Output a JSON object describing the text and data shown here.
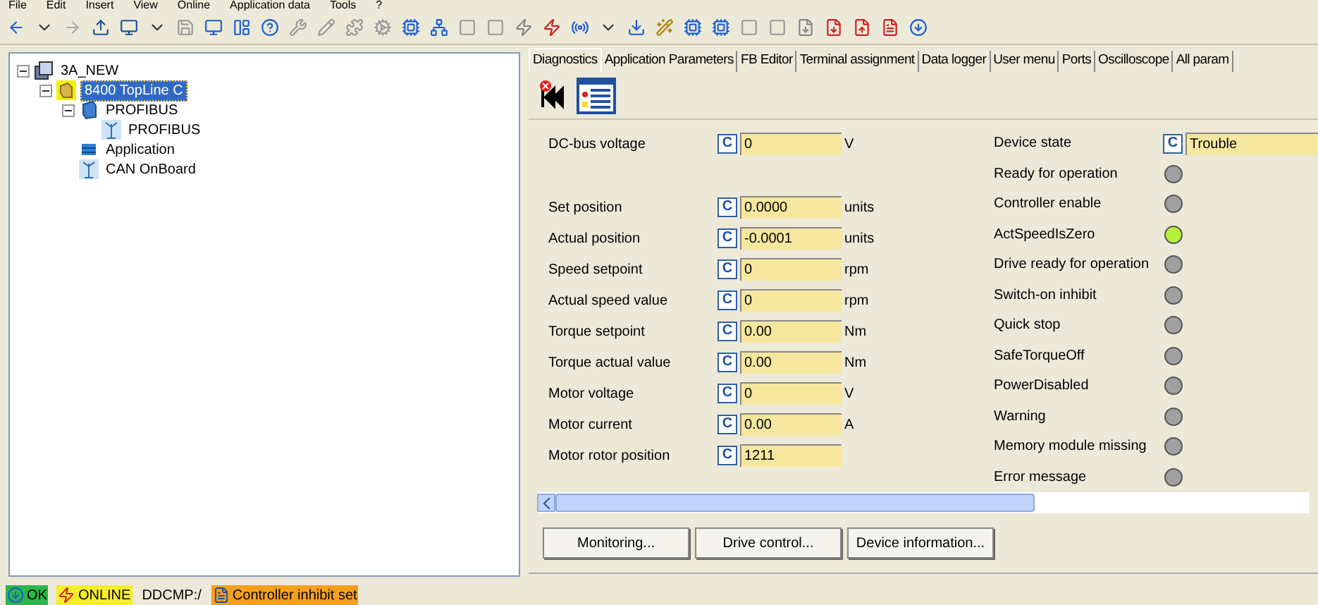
{
  "menu": [
    "File",
    "Edit",
    "Insert",
    "View",
    "Online",
    "Application data",
    "Tools",
    "?"
  ],
  "tree": [
    {
      "label": "3A_NEW",
      "kind": "project",
      "selected": false,
      "expanded": true,
      "children": [
        {
          "label": "8400 TopLine C",
          "kind": "device",
          "selected": true,
          "expanded": true,
          "children": [
            {
              "label": "PROFIBUS",
              "kind": "module",
              "selected": false,
              "expanded": true,
              "children": [
                {
                  "label": "PROFIBUS",
                  "kind": "bus",
                  "selected": false
                }
              ]
            },
            {
              "label": "Application",
              "kind": "app",
              "selected": false
            },
            {
              "label": "CAN OnBoard",
              "kind": "bus",
              "selected": false
            }
          ]
        }
      ]
    }
  ],
  "tabs": [
    {
      "label": "Diagnostics",
      "selected": true
    },
    {
      "label": "Application Parameters",
      "selected": false
    },
    {
      "label": "FB Editor",
      "selected": false
    },
    {
      "label": "Terminal assignment",
      "selected": false
    },
    {
      "label": "Data logger",
      "selected": false
    },
    {
      "label": "User menu",
      "selected": false
    },
    {
      "label": "Ports",
      "selected": false
    },
    {
      "label": "Oscilloscope",
      "selected": false
    },
    {
      "label": "All param",
      "selected": false
    }
  ],
  "parameters": [
    {
      "label": "DC-bus voltage",
      "button": "C",
      "value": "0",
      "unit": "V"
    },
    {
      "label": "Set position",
      "button": "C",
      "value": "0.0000",
      "unit": "units"
    },
    {
      "label": "Actual position",
      "button": "C",
      "value": "-0.0001",
      "unit": "units"
    },
    {
      "label": "Speed setpoint",
      "button": "C",
      "value": "0",
      "unit": "rpm"
    },
    {
      "label": "Actual speed value",
      "button": "C",
      "value": "0",
      "unit": "rpm"
    },
    {
      "label": "Torque setpoint",
      "button": "C",
      "value": "0.00",
      "unit": "Nm"
    },
    {
      "label": "Torque actual value",
      "button": "C",
      "value": "0.00",
      "unit": "Nm"
    },
    {
      "label": "Motor voltage",
      "button": "C",
      "value": "0",
      "unit": "V"
    },
    {
      "label": "Motor current",
      "button": "C",
      "value": "0.00",
      "unit": "A"
    },
    {
      "label": "Motor rotor position",
      "button": "C",
      "value": "1211"
    }
  ],
  "device_state": {
    "label": "Device state",
    "button": "C",
    "value": "Trouble"
  },
  "indicators": [
    {
      "label": "Ready for operation",
      "color": "#a0a0a0"
    },
    {
      "label": "Controller enable",
      "color": "#a0a0a0"
    },
    {
      "label": "ActSpeedIsZero",
      "color": "#b4f03c"
    },
    {
      "label": "Drive ready for operation",
      "color": "#a0a0a0"
    },
    {
      "label": "Switch-on inhibit",
      "color": "#a0a0a0"
    },
    {
      "label": "Quick stop",
      "color": "#a0a0a0"
    },
    {
      "label": "SafeTorqueOff",
      "color": "#a0a0a0"
    },
    {
      "label": "PowerDisabled",
      "color": "#a0a0a0"
    },
    {
      "label": "Warning",
      "color": "#a0a0a0"
    },
    {
      "label": "Memory module missing",
      "color": "#a0a0a0"
    },
    {
      "label": "Error message",
      "color": "#a0a0a0"
    }
  ],
  "buttons": [
    "Monitoring...",
    "Drive control...",
    "Device information..."
  ],
  "status_bar": [
    {
      "kind": "ok",
      "text": "OK"
    },
    {
      "kind": "online",
      "text": "ONLINE"
    },
    {
      "kind": "plain",
      "text": "DDCMP:/"
    },
    {
      "kind": "warning",
      "text": "Controller inhibit set"
    }
  ]
}
